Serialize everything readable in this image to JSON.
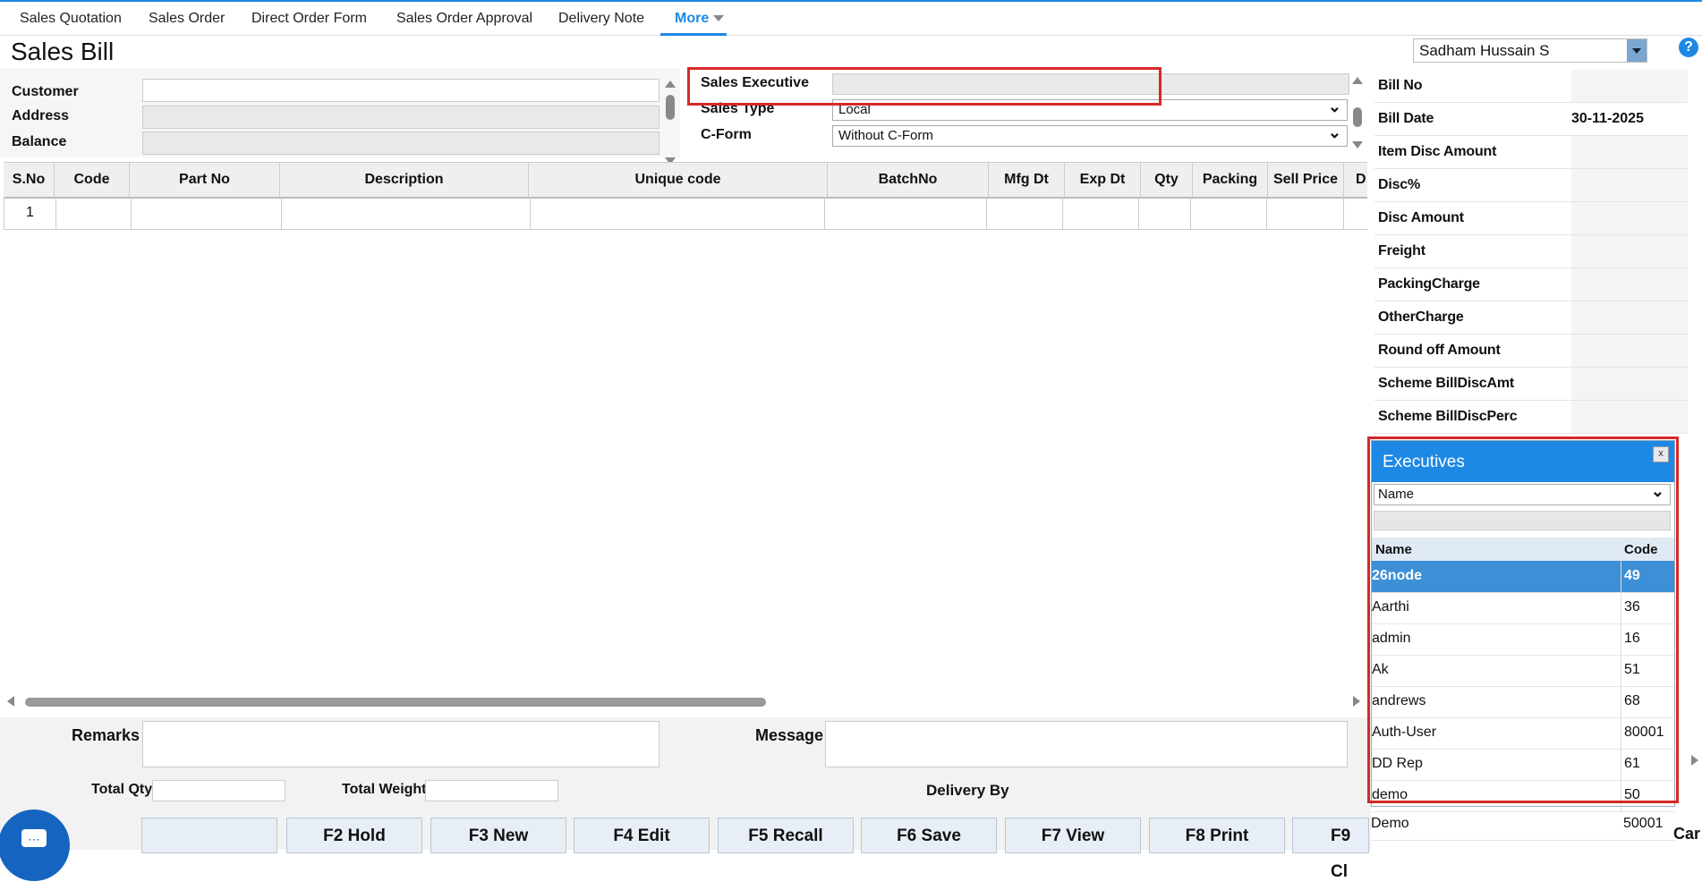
{
  "nav": {
    "items": [
      "Sales Quotation",
      "Sales Order",
      "Direct Order Form",
      "Sales Order Approval",
      "Delivery Note"
    ],
    "more": "More"
  },
  "page_title": "Sales Bill",
  "user": {
    "name": "Sadham Hussain S",
    "help": "?"
  },
  "header_form": {
    "customer_label": "Customer",
    "address_label": "Address",
    "balance_label": "Balance",
    "sales_executive_label": "Sales Executive",
    "sales_type_label": "Sales Type",
    "sales_type_value": "Local",
    "cform_label": "C-Form",
    "cform_value": "Without C-Form"
  },
  "grid": {
    "columns": [
      "S.No",
      "Code",
      "Part No",
      "Description",
      "Unique code",
      "BatchNo",
      "Mfg Dt",
      "Exp Dt",
      "Qty",
      "Packing",
      "Sell Price",
      "D"
    ],
    "rows": [
      [
        "1",
        "",
        "",
        "",
        "",
        "",
        "",
        "",
        "",
        "",
        "",
        ""
      ]
    ]
  },
  "bottom": {
    "remarks_label": "Remarks",
    "message_label": "Message",
    "total_qty_label": "Total Qty",
    "total_weight_label": "Total Weight",
    "delivery_by_label": "Delivery By",
    "buttons": [
      "",
      "F2 Hold",
      "F3 New",
      "F4 Edit",
      "F5 Recall",
      "F6 Save",
      "F7 View",
      "F8 Print",
      "F9 Cl"
    ]
  },
  "summary": {
    "rows": [
      {
        "label": "Bill No",
        "value": ""
      },
      {
        "label": "Bill Date",
        "value": "30-11-2025"
      },
      {
        "label": "Item Disc Amount",
        "value": ""
      },
      {
        "label": "Disc%",
        "value": ""
      },
      {
        "label": "Disc Amount",
        "value": ""
      },
      {
        "label": "Freight",
        "value": ""
      },
      {
        "label": "PackingCharge",
        "value": ""
      },
      {
        "label": "OtherCharge",
        "value": ""
      },
      {
        "label": "Round off Amount",
        "value": ""
      },
      {
        "label": "Scheme BillDiscAmt",
        "value": ""
      },
      {
        "label": "Scheme BillDiscPerc",
        "value": ""
      }
    ]
  },
  "executives_popup": {
    "title": "Executives",
    "close": "x",
    "filter_value": "Name",
    "col_name": "Name",
    "col_code": "Code",
    "rows": [
      {
        "name": "26node",
        "code": "49"
      },
      {
        "name": "Aarthi",
        "code": "36"
      },
      {
        "name": "admin",
        "code": "16"
      },
      {
        "name": "Ak",
        "code": "51"
      },
      {
        "name": "andrews",
        "code": "68"
      },
      {
        "name": "Auth-User",
        "code": "80001"
      },
      {
        "name": "DD Rep",
        "code": "61"
      },
      {
        "name": "demo",
        "code": "50"
      }
    ],
    "below_row": {
      "name": "Demo",
      "code": "50001",
      "extra": "Car"
    }
  },
  "colors": {
    "accent": "#1e88e5",
    "highlight_red": "#d62828",
    "selected_row": "#3d8fd6"
  }
}
